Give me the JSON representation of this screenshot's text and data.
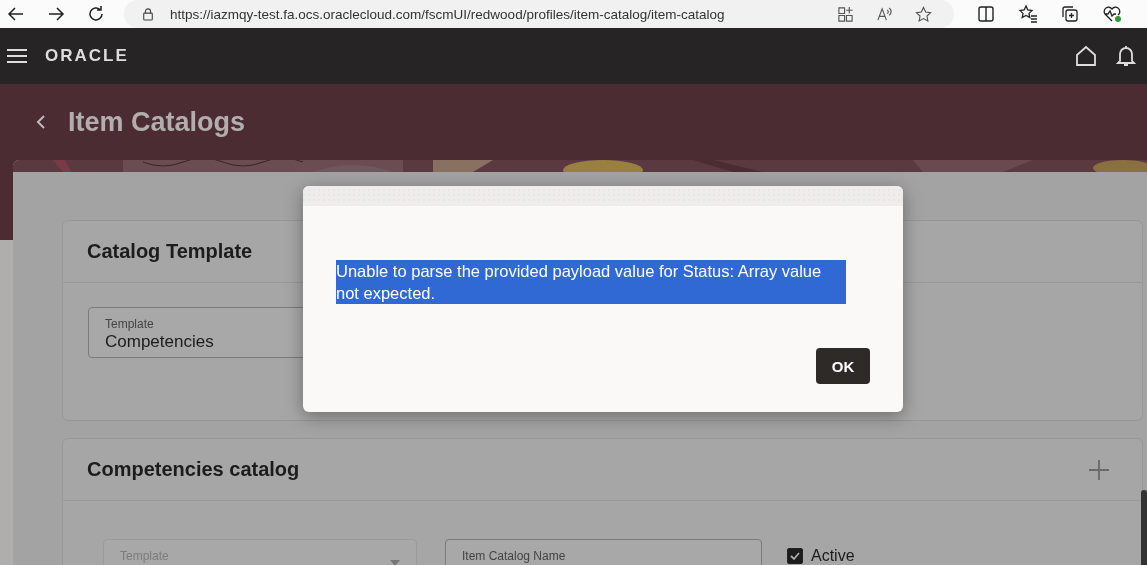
{
  "browser": {
    "address": "https://iazmqy-test.fa.ocs.oraclecloud.com/fscmUI/redwood/profiles/item-catalog/item-catalog"
  },
  "header": {
    "logo": "ORACLE"
  },
  "page": {
    "title": "Item Catalogs"
  },
  "sections": [
    {
      "title": "Catalog Template",
      "fields": [
        {
          "label": "Template",
          "value": "Competencies",
          "disabled": false,
          "kind": "text"
        }
      ]
    },
    {
      "title": "Competencies catalog",
      "fields": [
        {
          "label": "Template",
          "disabled": true,
          "kind": "select"
        },
        {
          "label": "Item Catalog Name",
          "disabled": false,
          "kind": "text"
        }
      ],
      "checkbox": {
        "label": "Active",
        "checked": true
      }
    }
  ],
  "dialog": {
    "message": "Unable to parse the provided payload value for Status: Array value not expected.",
    "selected": true,
    "buttons": [
      "OK"
    ]
  }
}
